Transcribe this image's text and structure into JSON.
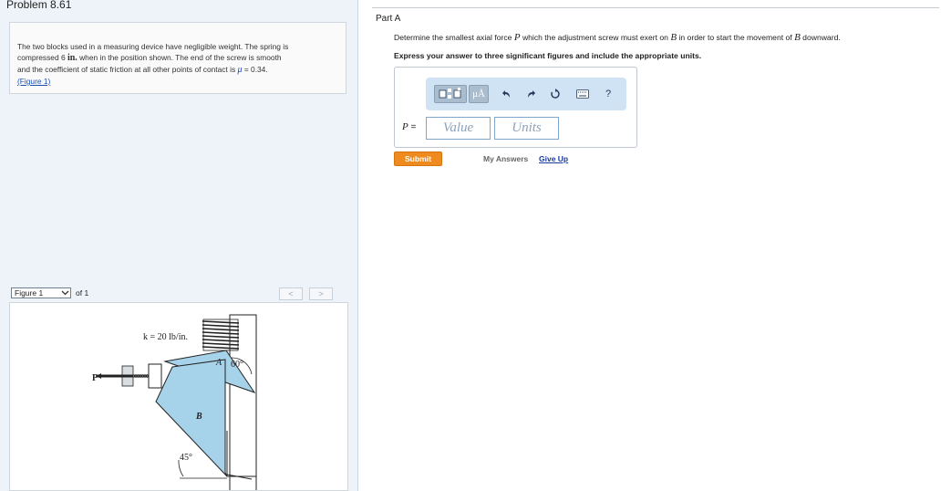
{
  "problem": {
    "title": "Problem 8.61"
  },
  "intro": {
    "line1": "The two blocks used in a measuring device have negligible weight. The spring is",
    "line2_pre": "compressed 6 ",
    "line2_unit": "in.",
    "line2_post": " when in the position shown. The end of the screw is smooth",
    "line3_pre": "and the coefficient of static friction at all other points of contact is ",
    "line3_mu": "μ",
    "line3_post": " = 0.34.",
    "figure_link": "(Figure 1)"
  },
  "figure_nav": {
    "select_value": "Figure 1",
    "of_label": "of 1",
    "prev": "<",
    "next": ">"
  },
  "figure": {
    "spring_label": "k = 20 lb/in.",
    "label_A": "A",
    "angle_60": "60°",
    "label_P": "P",
    "label_B": "B",
    "angle_45": "45°",
    "colors": {
      "block": "#a6d3ea",
      "outline": "#222222"
    }
  },
  "part": {
    "title": "Part A",
    "question_pre": "Determine the smallest axial force ",
    "question_P": "P",
    "question_mid1": " which the adjustment screw must exert on ",
    "question_B1": "B",
    "question_mid2": " in order to start the movement of ",
    "question_B2": "B",
    "question_post": " downward.",
    "instruction": "Express your answer to three significant figures and include the appropriate units."
  },
  "toolbar": {
    "templates_icon": "templates-icon",
    "units_label": "μÅ",
    "undo_icon": "undo-icon",
    "redo_icon": "redo-icon",
    "reset_icon": "reset-icon",
    "keyboard_icon": "keyboard-icon",
    "help_label": "?"
  },
  "answer": {
    "variable": "P",
    "equals": " =",
    "value_placeholder": "Value",
    "units_placeholder": "Units"
  },
  "actions": {
    "submit": "Submit",
    "my_answers": "My Answers",
    "give_up": "Give Up"
  },
  "colors": {
    "accent": "#ee8a1e",
    "link": "#1a4fb0",
    "toolbar_bg": "#cfe3f5"
  }
}
